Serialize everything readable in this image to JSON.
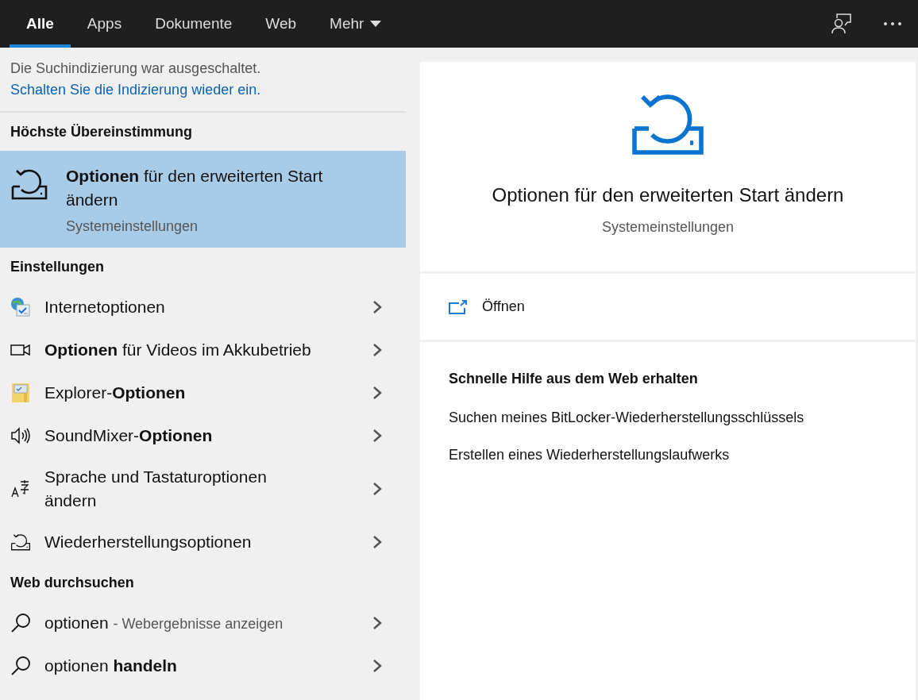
{
  "tabs": [
    {
      "label": "Alle",
      "selected": true,
      "dropdown": false
    },
    {
      "label": "Apps",
      "selected": false,
      "dropdown": false
    },
    {
      "label": "Dokumente",
      "selected": false,
      "dropdown": false
    },
    {
      "label": "Web",
      "selected": false,
      "dropdown": false
    },
    {
      "label": "Mehr",
      "selected": false,
      "dropdown": true
    }
  ],
  "notice": {
    "text": "Die Suchindizierung war ausgeschaltet.",
    "link": "Schalten Sie die Indizierung wieder ein."
  },
  "best_match": {
    "heading": "Höchste Übereinstimmung",
    "title": "**Optionen** für den erweiterten Start ändern",
    "subtitle": "Systemeinstellungen",
    "selected": true
  },
  "settings": {
    "heading": "Einstellungen",
    "items": [
      {
        "title": "Internetoptionen"
      },
      {
        "title": "**Optionen** für Videos im Akkubetrieb"
      },
      {
        "title": "Explorer-**Optionen**"
      },
      {
        "title": "SoundMixer-**Optionen**"
      },
      {
        "title": "Sprache und Tastaturoptionen ändern"
      },
      {
        "title": "Wiederherstellungsoptionen"
      }
    ]
  },
  "web": {
    "heading": "Web durchsuchen",
    "items": [
      {
        "title": "optionen",
        "suffix": "- Webergebnisse anzeigen"
      },
      {
        "title": "optionen **handeln**"
      }
    ]
  },
  "preview": {
    "title": "Optionen für den erweiterten Start ändern",
    "subtitle": "Systemeinstellungen",
    "open_label": "Öffnen",
    "help_heading": "Schnelle Hilfe aus dem Web erhalten",
    "links": [
      "Suchen meines BitLocker-Wiederherstellungsschlüssels",
      "Erstellen eines Wiederherstellungslaufwerks"
    ]
  }
}
